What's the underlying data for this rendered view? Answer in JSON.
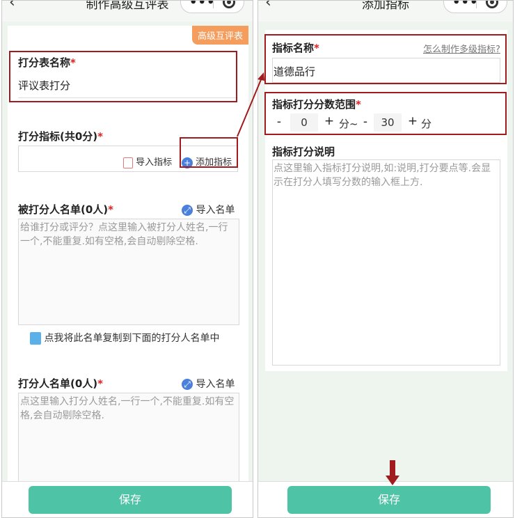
{
  "left": {
    "nav_title": "制作高级互评表",
    "badge": "高级互评表",
    "name_label": "打分表名称",
    "name_value": "评议表打分",
    "indicator_label": "打分指标(共0分)",
    "import_indicator": "导入指标",
    "add_indicator": "添加指标",
    "rated_label": "被打分人名单(0人)",
    "import_list": "导入名单",
    "rated_placeholder": "给谁打分或评分？点这里输入被打分人姓名,一行一个,不能重复.如有空格,会自动剔除空格.",
    "copy_text": "点我将此名单复制到下面的打分人名单中",
    "raters_label": "打分人名单(0人)",
    "import_list2": "导入名单",
    "raters_placeholder": "点这里输入打分人姓名,一行一个,不能重复.如有空格,会自动剔除空格.",
    "save": "保存"
  },
  "right": {
    "nav_title": "添加指标",
    "name_label": "指标名称",
    "multi_link": "怎么制作多级指标?",
    "name_value": "道德品行",
    "range_label": "指标打分分数范围",
    "min_value": "0",
    "max_value": "30",
    "minus": "-",
    "plus": "+",
    "unit_mid": "分~",
    "unit_end": "分",
    "desc_label": "指标打分说明",
    "desc_placeholder": "点这里输入指标打分说明,如:说明,打分要点等.会显示在打分人填写分数的输入框上方.",
    "save": "保存"
  },
  "required_mark": "*",
  "colors": {
    "accent": "#4fc3a6",
    "highlight": "#a11a1e",
    "badge": "#f59d5c",
    "required": "#e02020"
  }
}
